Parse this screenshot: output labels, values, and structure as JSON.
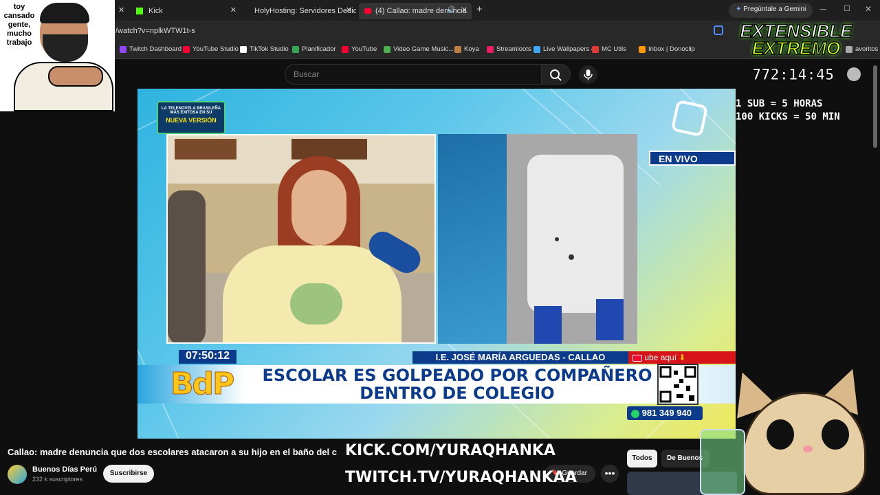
{
  "browser": {
    "tabs": [
      {
        "label": "Kick",
        "color": "#53fc18"
      },
      {
        "label": "HolyHosting: Servidores Dedica",
        "color": "#ffffff"
      },
      {
        "label": "(4) Callao: madre denuncia",
        "color": "#ff0033"
      }
    ],
    "gemini": "Pregúntale a Gemini",
    "url": "/watch?v=nplkWTW1t-s",
    "bookmarks": [
      {
        "label": "Twitch Dashboard",
        "color": "#9146ff"
      },
      {
        "label": "YouTube Studio",
        "color": "#ff0033"
      },
      {
        "label": "TikTok Studio",
        "color": "#ffffff"
      },
      {
        "label": "Planificador",
        "color": "#34a853"
      },
      {
        "label": "YouTube",
        "color": "#ff0033"
      },
      {
        "label": "Video Game Music...",
        "color": "#4caf50"
      },
      {
        "label": "Koya",
        "color": "#c08040"
      },
      {
        "label": "Streamloots",
        "color": "#e91e63"
      },
      {
        "label": "Live Wallpapers 4K",
        "color": "#3fa9f5"
      },
      {
        "label": "MC Utils",
        "color": "#e53935"
      },
      {
        "label": "Inbox | Donoclip",
        "color": "#ff9800"
      },
      {
        "label": "avoritos",
        "color": "#aaa"
      }
    ]
  },
  "youtube": {
    "search_placeholder": "Buscar",
    "video_title": "Callao: madre denuncia que dos escolares atacaron a su hijo en el baño del c",
    "channel_name": "Buenos Días Perú",
    "subscribers": "232 k suscriptores",
    "subscribe_label": "Suscribirse",
    "save_label": "Guardar",
    "chips": [
      "Todos",
      "De Buenos"
    ]
  },
  "broadcast": {
    "promo_line1": "LA TELENOVELA BRASILEÑA",
    "promo_line2": "MÁS EXITOSA EN SU",
    "promo_line3": "NUEVA VERSIÓN",
    "live_badge": "EN VIVO",
    "clock": "07:50:12",
    "location": "I.E. JOSÉ MARÍA ARGUEDAS - CALLAO",
    "subscribe_cta": "ube aquí",
    "logo": "BdP",
    "headline_1": "ESCOLAR ES GOLPEADO POR COMPAÑERO",
    "headline_2": "DENTRO DE COLEGIO",
    "whatsapp": "981 349 940"
  },
  "stream_overlay": {
    "webcam_caption": "toy cansado gente, mucho trabajo",
    "event_title_1": "EXTENSIBLE",
    "event_title_2": "EXTREMO",
    "timer": "772:14:45",
    "rule_1": "1 SUB = 5 HORAS",
    "rule_2": "100 KICKS = 50 MIN",
    "kick_url": "KICK.COM/YURAQHANKA",
    "twitch_url": "TWITCH.TV/YURAQHANKAA",
    "kick_color": "#53fc18",
    "twitch_color": "#9146ff"
  }
}
